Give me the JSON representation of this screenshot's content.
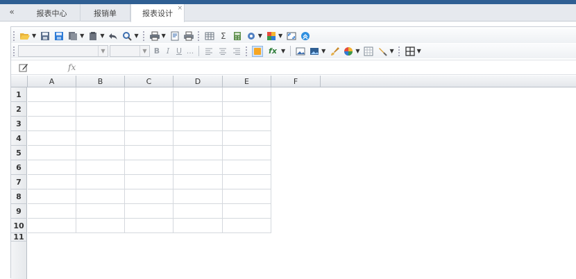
{
  "tabs": {
    "collapse_glyph": "«",
    "items": [
      {
        "label": "报表中心"
      },
      {
        "label": "报销单"
      },
      {
        "label": "报表设计",
        "close": "×"
      }
    ]
  },
  "formula": {
    "fx_label": "fx",
    "value": ""
  },
  "sheet": {
    "columns": [
      "A",
      "B",
      "C",
      "D",
      "E",
      "F"
    ],
    "rows": [
      "1",
      "2",
      "3",
      "4",
      "5",
      "6",
      "7",
      "8",
      "9",
      "10",
      "11"
    ]
  },
  "toolbar": {
    "font_name": "",
    "font_size": "",
    "bold": "B",
    "italic": "I",
    "underline": "U",
    "more": "...",
    "sigma": "Σ",
    "fx2": "fx"
  },
  "colors": {
    "topbar": "#2f5f93",
    "accent_blue": "#2e7bd6",
    "grid": "#d4d8dd"
  }
}
